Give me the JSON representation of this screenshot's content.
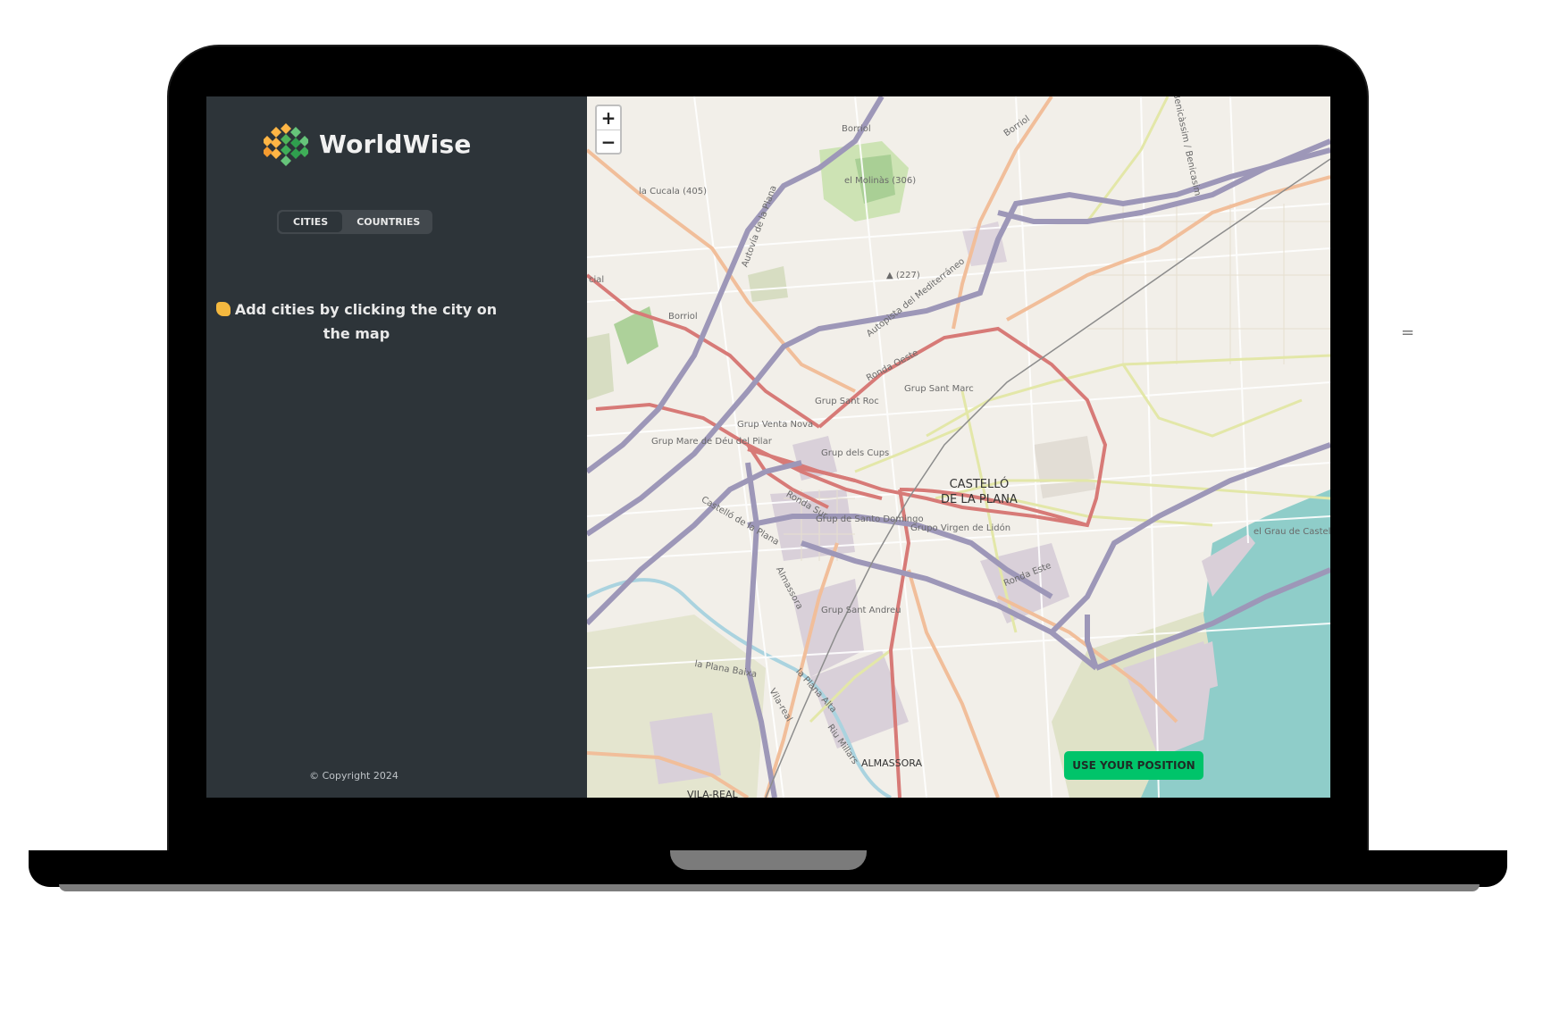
{
  "app": {
    "name": "WorldWise"
  },
  "tabs": [
    {
      "label": "CITIES",
      "active": true
    },
    {
      "label": "COUNTRIES",
      "active": false
    }
  ],
  "hint": {
    "text": "Add cities by clicking the city on the map",
    "icon": "waving-hand-icon"
  },
  "footer": {
    "copyright": "© Copyright 2024"
  },
  "map": {
    "zoom_in": "+",
    "zoom_out": "−",
    "use_position_label": "USE YOUR POSITION",
    "labels": {
      "castello": "CASTELLÓ",
      "de_la_plana": "DE LA PLANA",
      "almassora": "ALMASSORA",
      "vila_real": "VILA-REAL",
      "borriol_1": "Borriol",
      "borriol_2": "Borriol",
      "borriol_3": "Borriol",
      "cucala": "la Cucala (405)",
      "molinas": "el Molinàs (306)",
      "peak_227": "▲ (227)",
      "ronda_oeste": "Ronda Oeste",
      "ronda_sur": "Ronda Sur",
      "ronda_este": "Ronda Este",
      "autopista": "Autopista del Mediterráneo",
      "autovia": "Autovía de la Plana",
      "grup_sant_roc": "Grup Sant Roc",
      "grup_sant_marc": "Grup Sant Marc",
      "grup_venta_nova": "Grup Venta Nova",
      "grup_mare_deu": "Grup Mare de Déu del Pilar",
      "grup_dels_cups": "Grup dels Cups",
      "grup_santo_domingo": "Grup de Santo Domingo",
      "grupo_virgen_lidon": "Grupo Virgen de Lidón",
      "grup_sant_andreu": "Grup Sant Andreu",
      "el_grau": "el Grau de Castelló",
      "la_plana_baixa": "la Plana Baixa",
      "la_plana_alta": "la Plana Alta",
      "castello_de_la_plana_road": "Castelló de la Plana",
      "benicassim": "Benicàssim / Benicasim",
      "almassora_road": "Almassora",
      "vila_real_road": "Vila-real",
      "riu_millars": "Riu Millars",
      "cial": "cial"
    }
  },
  "side_mark": "="
}
